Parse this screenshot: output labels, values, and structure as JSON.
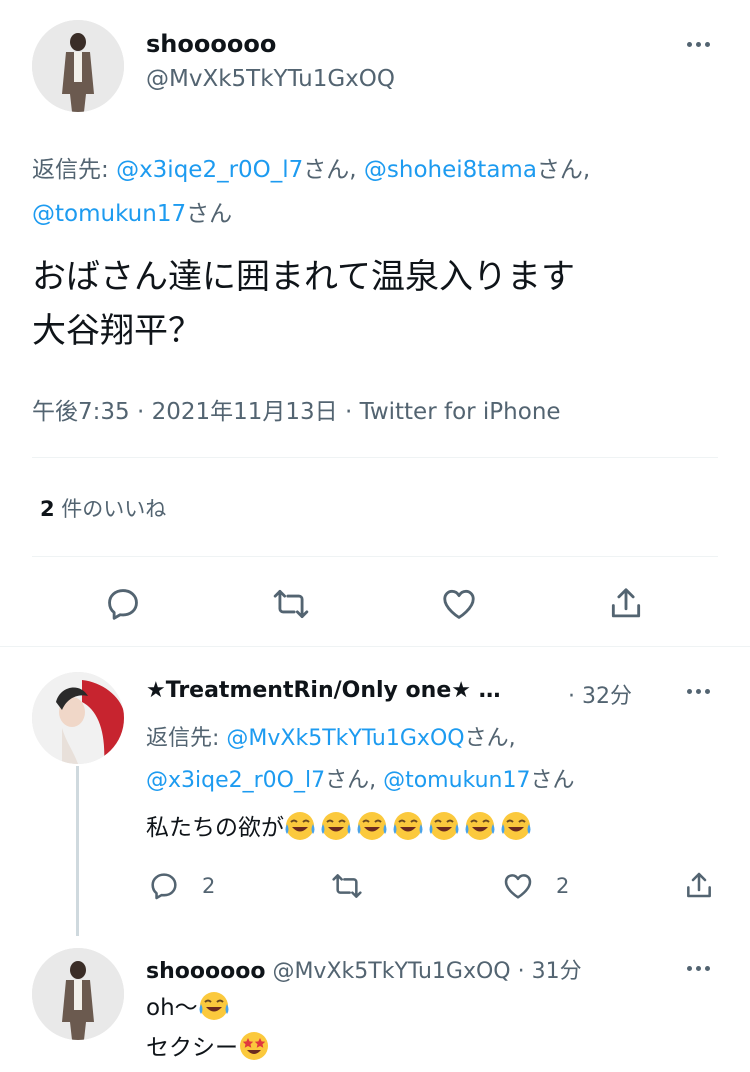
{
  "main_tweet": {
    "display_name": "shoooooo",
    "handle": "@MvXk5TkYTu1GxOQ",
    "reply_prefix": "返信先: ",
    "reply_to": [
      {
        "handle": "@x3iqe2_r0O_l7",
        "suffix": "さん, "
      },
      {
        "handle": "@shohei8tama",
        "suffix": "さん,"
      },
      {
        "handle": "@tomukun17",
        "suffix": "さん"
      }
    ],
    "text_line1": "おばさん達に囲まれて温泉入ります",
    "text_line2": "大谷翔平？",
    "timestamp": "午後7:35 · 2021年11月13日 · Twitter for iPhone",
    "likes_count": "2",
    "likes_label": " 件のいいね"
  },
  "reply_1": {
    "display_name": "★TreatmentRin/Only one★ …",
    "time": "· 32分",
    "reply_prefix": "返信先: ",
    "reply_to": [
      {
        "handle": "@MvXk5TkYTu1GxOQ",
        "suffix": "さん,"
      },
      {
        "handle": "@x3iqe2_r0O_l7",
        "suffix": "さん, "
      },
      {
        "handle": "@tomukun17",
        "suffix": "さん"
      }
    ],
    "text": "私たちの欲が",
    "emoji": "face-with-tears-of-joy x7",
    "reply_count": "2",
    "like_count": "2"
  },
  "reply_2": {
    "display_name": "shoooooo",
    "handle": "@MvXk5TkYTu1GxOQ",
    "time": "· 31分",
    "text_line1": "oh〜",
    "text_line2": "セクシー",
    "emoji1": "face-with-tears-of-joy",
    "emoji2": "star-struck"
  },
  "colors": {
    "link": "#1d9bf0",
    "secondary": "#536471",
    "divider": "#eff3f4"
  }
}
